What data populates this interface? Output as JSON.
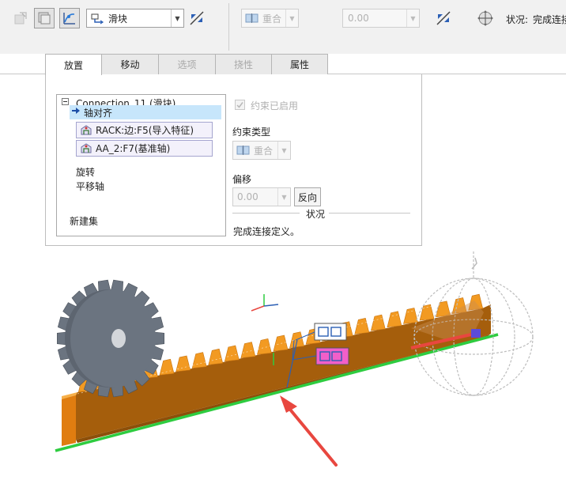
{
  "toolbar": {
    "connection_type": "滑块",
    "constraint_type": "重合",
    "offset_value": "0.00",
    "status_label": "状况:",
    "status_text": "完成连接"
  },
  "tabs": [
    {
      "label": "放置",
      "state": "active"
    },
    {
      "label": "移动",
      "state": "normal"
    },
    {
      "label": "选项",
      "state": "disabled"
    },
    {
      "label": "挠性",
      "state": "disabled"
    },
    {
      "label": "属性",
      "state": "normal"
    }
  ],
  "panel": {
    "tree": {
      "connection": "Connection_11 (滑块)",
      "axis_align": "轴对齐",
      "refs": [
        "RACK:边:F5(导入特征)",
        "AA_2:F7(基准轴)"
      ],
      "rotation": "旋转",
      "translation_axis": "平移轴",
      "new_set": "新建集"
    },
    "constraint_enabled": "约束已启用",
    "constraint_type_label": "约束类型",
    "constraint_type_value": "重合",
    "offset_label": "偏移",
    "offset_value": "0.00",
    "flip_button": "反向",
    "status_heading": "状况",
    "status_message": "完成连接定义。"
  },
  "colors": {
    "gear": "#6b7480",
    "rack": "#f29a22",
    "rack_dark": "#a55e0c",
    "ground_line": "#2ecc40",
    "arrow": "#e8473f",
    "selection": "#c7e6fb"
  }
}
